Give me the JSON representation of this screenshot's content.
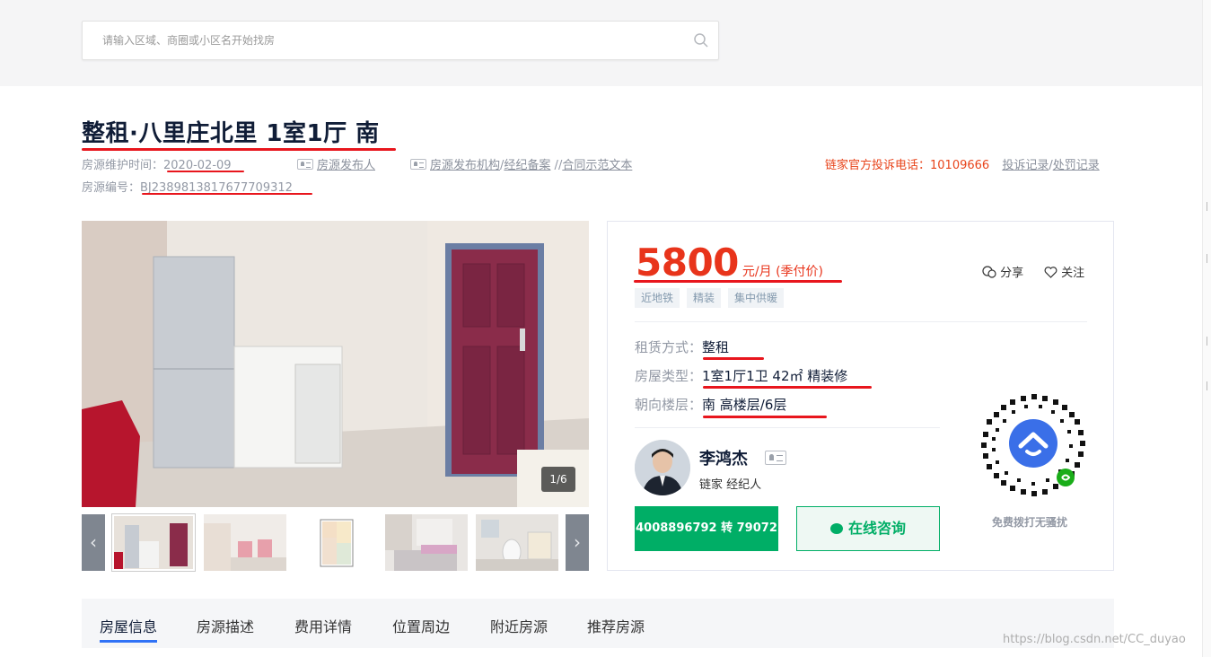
{
  "search": {
    "placeholder": "请输入区域、商圈或小区名开始找房"
  },
  "listing": {
    "title": "整租·八里庄北里 1室1厅 南",
    "maintain_label": "房源维护时间：",
    "maintain_date": "2020-02-09",
    "publisher_link": "房源发布人",
    "org_link": "房源发布机构",
    "sep1": "/",
    "agent_record_link": "经纪备案",
    "sep2": " /",
    "contract_link": "合同示范文本",
    "code_label": "房源编号：",
    "code_value": "BJ2389813817677709312",
    "complaint_label": "链家官方投诉电话：10109666",
    "complaint_link": "投诉记录",
    "sep3": "/",
    "penalty_link": "处罚记录"
  },
  "gallery": {
    "counter": "1/6",
    "prev_arrow": "‹",
    "next_arrow": "›",
    "thumbnail_count": 5
  },
  "price": {
    "amount": "5800",
    "unit": "元/月 (季付价)"
  },
  "actions": {
    "share": "分享",
    "follow": "关注"
  },
  "tags": [
    "近地铁",
    "精装",
    "集中供暖"
  ],
  "attributes": [
    {
      "key": "租赁方式：",
      "value": "整租"
    },
    {
      "key": "房屋类型：",
      "value": "1室1厅1卫 42㎡ 精装修"
    },
    {
      "key": "朝向楼层：",
      "value": "南 高楼层/6层"
    }
  ],
  "agent": {
    "name": "李鸿杰",
    "title": "链家 经纪人",
    "phone_button": "4008896792 转 79072",
    "consult_button": "在线咨询"
  },
  "qr": {
    "caption": "免费拨打无骚扰"
  },
  "tabs": [
    "房屋信息",
    "房源描述",
    "费用详情",
    "位置周边",
    "附近房源",
    "推荐房源"
  ],
  "active_tab": "房屋信息",
  "watermark": "https://blog.csdn.net/CC_duyao",
  "colors": {
    "accent_green": "#00ae66",
    "price_red": "#e8341b",
    "annotation_red": "#e8161d",
    "tab_blue": "#3072f6"
  }
}
